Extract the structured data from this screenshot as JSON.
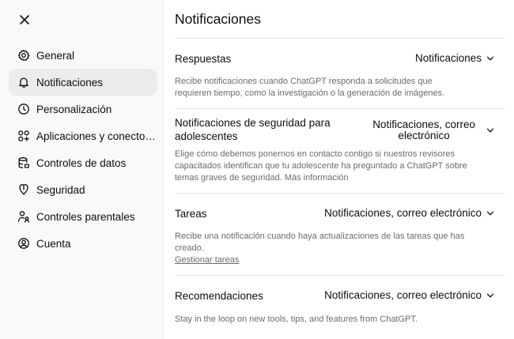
{
  "sidebar": {
    "close_label": "Cerrar",
    "items": [
      {
        "label": "General",
        "icon": "gear-icon"
      },
      {
        "label": "Notificaciones",
        "icon": "bell-icon",
        "active": true
      },
      {
        "label": "Personalización",
        "icon": "clock-icon"
      },
      {
        "label": "Aplicaciones y conectores",
        "icon": "apps-icon"
      },
      {
        "label": "Controles de datos",
        "icon": "database-icon"
      },
      {
        "label": "Seguridad",
        "icon": "shield-icon"
      },
      {
        "label": "Controles parentales",
        "icon": "parent-icon"
      },
      {
        "label": "Cuenta",
        "icon": "account-icon"
      }
    ]
  },
  "main": {
    "title": "Notificaciones",
    "sections": [
      {
        "label": "Respuestas",
        "value": "Notificaciones",
        "description": "Recibe notificaciones cuando ChatGPT responda a solicitudes que requieren tiempo, como la investigación o la generación de imágenes."
      },
      {
        "label_line1": "Notificaciones de seguridad para",
        "label_line2": "adolescentes",
        "value_line1": "Notificaciones, correo",
        "value_line2": "electrónico",
        "description": "Elige cómo debemos ponernos en contacto contigo si nuestros revisores capacitados identifican que tu adolescente ha preguntado a ChatGPT sobre temas graves de seguridad.",
        "link": "Más información"
      },
      {
        "label": "Tareas",
        "value": "Notificaciones, correo electrónico",
        "description": "Recibe una notificación cuando haya actualizaciones de las tareas que has creado.",
        "link": "Gestionar tareas"
      },
      {
        "label": "Recomendaciones",
        "value": "Notificaciones, correo electrónico",
        "description": "Stay in the loop on new tools, tips, and features from ChatGPT."
      }
    ]
  },
  "colors": {
    "sidebar_bg": "#f9f9f9",
    "active_bg": "#ececec",
    "muted_text": "#6b6b6b",
    "divider": "#e5e5e5"
  }
}
